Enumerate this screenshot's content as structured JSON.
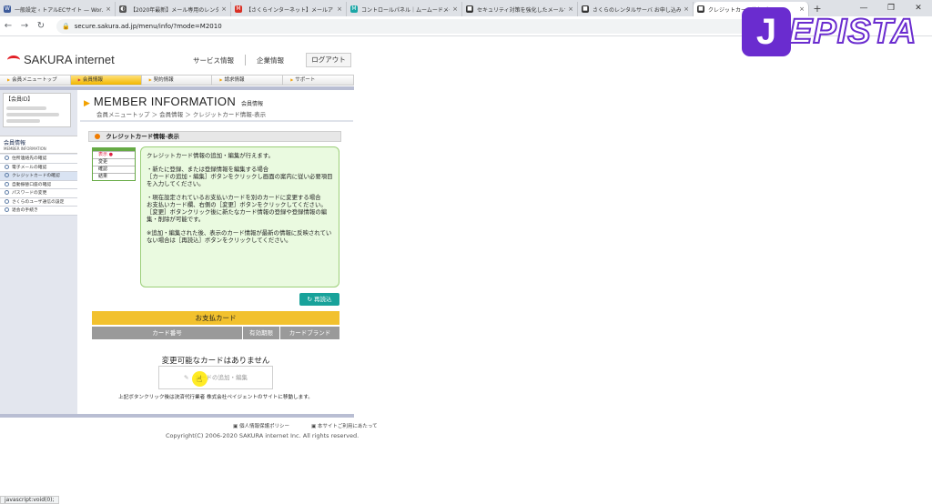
{
  "browser": {
    "tabs": [
      {
        "title": "一般設定 ‹ トアルECサイト — Wor…",
        "fav": "W",
        "color": "#3c5a9a"
      },
      {
        "title": "【2020年最新】メール専用のレンタル…",
        "fav": "◐",
        "color": "#555555"
      },
      {
        "title": "【さくらインターネット】メールアドレスの…",
        "fav": "M",
        "color": "#d93025"
      },
      {
        "title": "コントロールパネル｜ムームードメイン",
        "fav": "M",
        "color": "#1aa6a6"
      },
      {
        "title": "セキュリティ対策を強化したメールサ…",
        "fav": "■",
        "color": "#333333"
      },
      {
        "title": "さくらのレンタルサーバ お申し込み",
        "fav": "■",
        "color": "#333333"
      },
      {
        "title": "クレジットカード情報-表示",
        "fav": "■",
        "color": "#333333"
      }
    ],
    "close_glyph": "×",
    "new_tab": "+",
    "url": "secure.sakura.ad.jp/menu/info/?mode=M2010",
    "status": "javascript:void(0);"
  },
  "logo": {
    "initial": "J",
    "rest": "EPISTA"
  },
  "header": {
    "brand": "SAKURA internet",
    "links": [
      "サービス情報",
      "企業情報"
    ],
    "logout": "ログアウト"
  },
  "gnav": [
    "会員メニュートップ",
    "会員情報",
    "契約情報",
    "請求情報",
    "サポート"
  ],
  "sidebar": {
    "member_label": "【会員ID】",
    "section_title": "会員情報",
    "section_sub": "MEMBER INFORMATION",
    "items": [
      "住所連絡先の確認",
      "電子メールの確認",
      "クレジットカードの確認",
      "自動振替口座の確認",
      "パスワードの変更",
      "さくらのユーザ通信の設定",
      "退会の手続き"
    ],
    "active_index": 2
  },
  "main": {
    "title_en": "MEMBER INFORMATION",
    "title_ja": "会員情報",
    "breadcrumb": "会員メニュートップ ＞ 会員情報 ＞ クレジットカード情報-表示",
    "section": "クレジットカード情報-表示",
    "legend": [
      "表示",
      "変更",
      "確認",
      "結果"
    ],
    "info": [
      "クレジットカード情報の追加・編集が行えます。",
      "・新たに登録、または登録情報を編集する場合\n［カードの追加・編集］ボタンをクリックし画面の案内に従い必要項目を入力してください。",
      "・現在設定されているお支払いカードを別のカードに変更する場合\nお支払いカード欄、右側の［変更］ボタンをクリックしてください。\n［変更］ボタンクリック後に新たなカード情報の登録や登録情報の編集・削除が可能です。",
      "※追加・編集された後、表示のカード情報が最新の情報に反映されていない場合は［再読込］ボタンをクリックしてください。"
    ],
    "reload": "再読込",
    "pay_title": "お支払カード",
    "pay_cols": [
      "カード番号",
      "有効期限",
      "カードブランド"
    ],
    "no_card": "変更可能なカードはありません",
    "add_button": "カードの追加・編集",
    "note": "上記ボタンクリック後は決済代行業者 株式会社ペイジェントのサイトに移動します。"
  },
  "footer": {
    "links": [
      "個人情報保護ポリシー",
      "本サイトご利用にあたって"
    ],
    "copyright": "Copyright(C) 2006-2020 SAKURA internet Inc. All rights reserved."
  }
}
